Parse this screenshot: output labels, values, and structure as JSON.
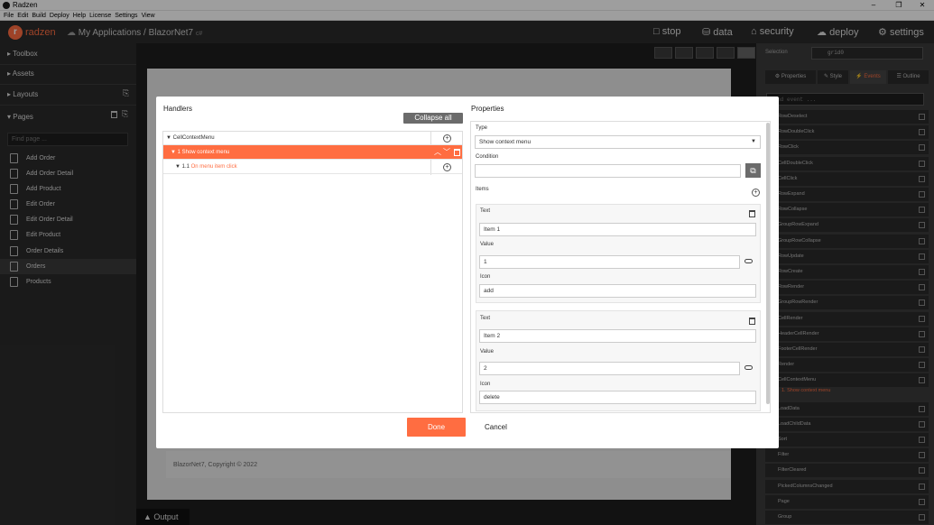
{
  "window": {
    "title": "Radzen",
    "controls": [
      "–",
      "❐",
      "✕"
    ]
  },
  "menu": [
    "File",
    "Edit",
    "Build",
    "Deploy",
    "Help",
    "License",
    "Settings",
    "View"
  ],
  "appbar": {
    "brand": "radzen",
    "logo_letter": "r",
    "breadcrumb": "My Applications / BlazorNet7",
    "lang_badge": "c#",
    "nav": [
      {
        "icon": "stop-icon",
        "glyph": "□",
        "label": "stop"
      },
      {
        "icon": "data-icon",
        "glyph": "⛁",
        "label": "data"
      },
      {
        "icon": "security-icon",
        "glyph": "⌂",
        "label": "security"
      },
      {
        "icon": "deploy-icon",
        "glyph": "☁",
        "label": "deploy"
      },
      {
        "icon": "settings-icon",
        "glyph": "⚙",
        "label": "settings"
      }
    ]
  },
  "sidebar": {
    "sections": [
      "Toolbox",
      "Assets",
      "Layouts",
      "Pages"
    ],
    "find_placeholder": "Find page ...",
    "pages": [
      "Add Order",
      "Add Order Detail",
      "Add Product",
      "Edit Order",
      "Edit Order Detail",
      "Edit Product",
      "Order Details",
      "Orders",
      "Products"
    ],
    "active_page": "Orders"
  },
  "canvas": {
    "footer": "BlazorNet7, Copyright © 2022",
    "output_tab": "Output"
  },
  "right_panel": {
    "selection_label": "Selection",
    "selection_value": "grid0",
    "tabs": [
      "Properties",
      "Style",
      "Events",
      "Outline"
    ],
    "active_tab": "Events",
    "find_placeholder": "Find event ...",
    "events": [
      "RowDeselect",
      "RowDoubleClick",
      "RowClick",
      "CellDoubleClick",
      "CellClick",
      "RowExpand",
      "RowCollapse",
      "GroupRowExpand",
      "GroupRowCollapse",
      "RowUpdate",
      "RowCreate",
      "RowRender",
      "GroupRowRender",
      "CellRender",
      "HeaderCellRender",
      "FooterCellRender",
      "Render",
      "CellContextMenu"
    ],
    "cellcontextmenu_handler": "1. Show context menu",
    "events_after": [
      "LoadData",
      "LoadChildData",
      "Sort",
      "Filter",
      "FilterCleared",
      "PickedColumnsChanged",
      "Page",
      "Group"
    ]
  },
  "dialog": {
    "handlers_title": "Handlers",
    "properties_title": "Properties",
    "collapse_all": "Collapse all",
    "tree": [
      {
        "label": "CellContextMenu",
        "level": 0,
        "highlight": false
      },
      {
        "label": "1 Show context menu",
        "level": 1,
        "highlight": true
      },
      {
        "label": "1.1",
        "action": "On menu item click",
        "level": 2,
        "highlight": false
      }
    ],
    "type_label": "Type",
    "type_value": "Show context menu",
    "condition_label": "Condition",
    "condition_value": "",
    "items_label": "Items",
    "items": [
      {
        "text_label": "Text",
        "text": "Item 1",
        "value_label": "Value",
        "value": "1",
        "icon_label": "Icon",
        "icon": "add"
      },
      {
        "text_label": "Text",
        "text": "Item 2",
        "value_label": "Value",
        "value": "2",
        "icon_label": "Icon",
        "icon": "delete"
      }
    ],
    "done": "Done",
    "cancel": "Cancel"
  }
}
